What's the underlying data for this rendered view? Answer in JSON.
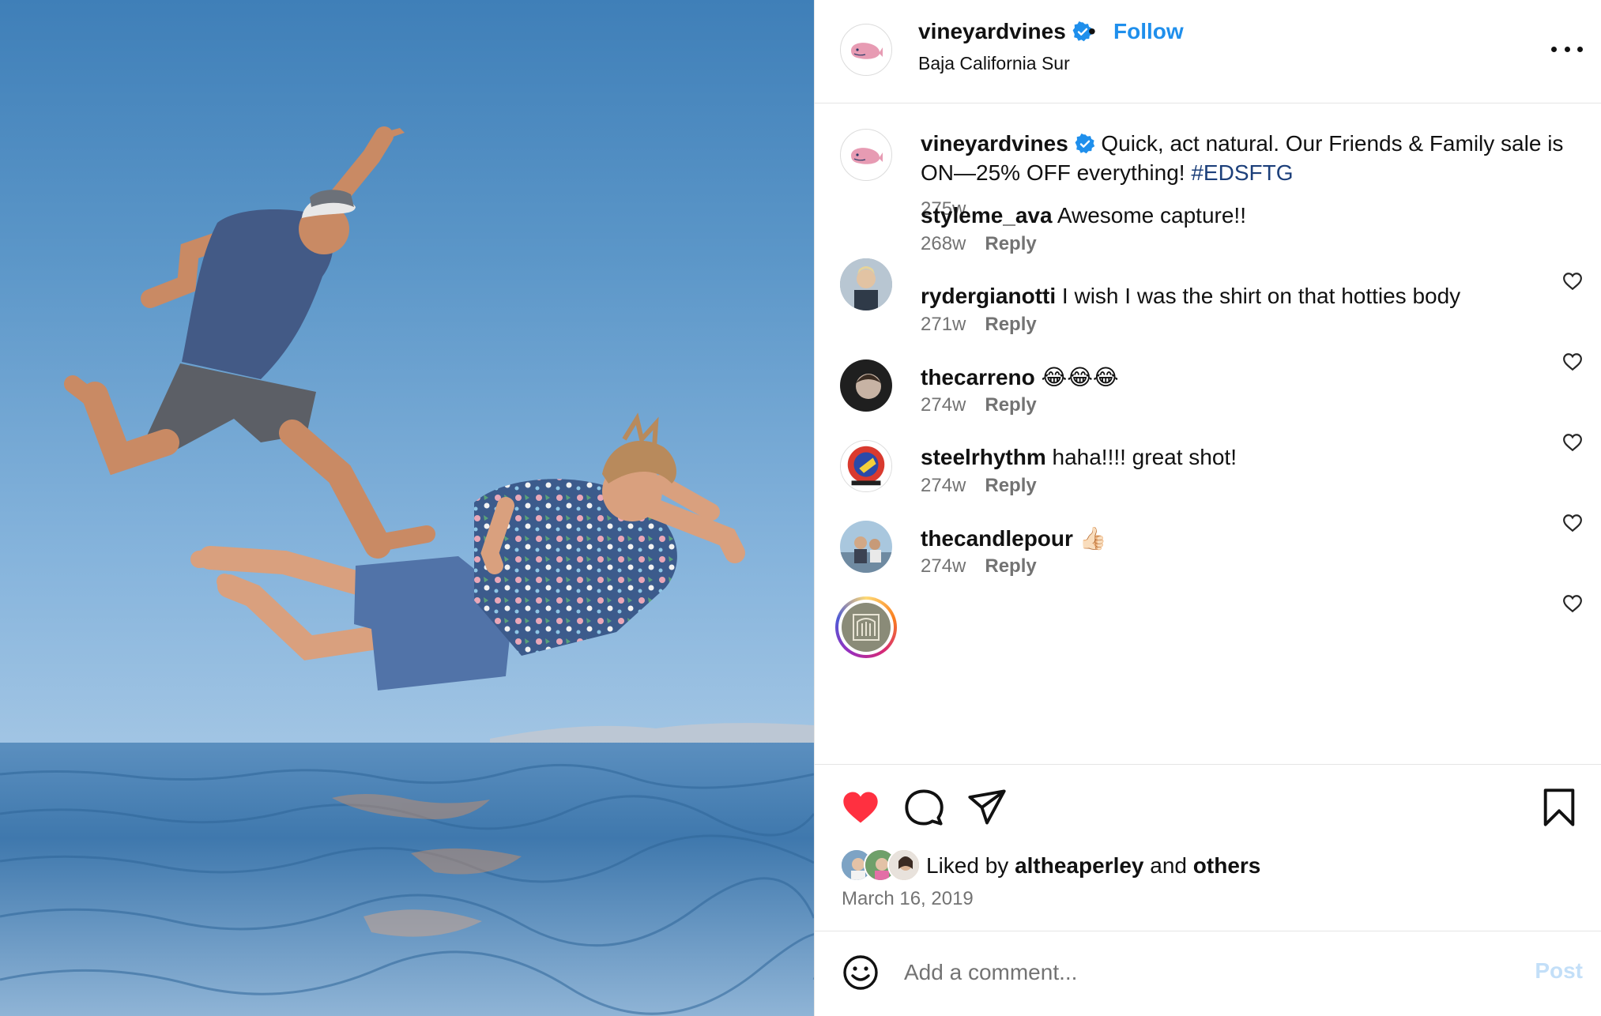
{
  "post": {
    "username": "vineyardvines",
    "verified": true,
    "follow_label": "Follow",
    "separator": "•",
    "location": "Baja California Sur",
    "more_icon": "more-horizontal-icon"
  },
  "caption": {
    "username": "vineyardvines",
    "text": "Quick, act natural. Our Friends & Family sale is ON—25% OFF everything! ",
    "hashtag": "#EDSFTG",
    "age": "275w"
  },
  "comments": [
    {
      "username": "styleme_ava",
      "text": "Awesome capture!!",
      "age": "268w",
      "reply_label": "Reply"
    },
    {
      "username": "rydergianotti",
      "text": "I wish I was the shirt on that hotties body",
      "age": "271w",
      "reply_label": "Reply"
    },
    {
      "username": "thecarreno",
      "text": "😂😂😂",
      "age": "274w",
      "reply_label": "Reply"
    },
    {
      "username": "steelrhythm",
      "text": "haha!!!! great shot!",
      "age": "274w",
      "reply_label": "Reply"
    },
    {
      "username": "thecandlepour",
      "text": "👍🏻",
      "age": "274w",
      "reply_label": "Reply"
    }
  ],
  "actions": {
    "like_icon": "heart-filled-icon",
    "comment_icon": "comment-bubble-icon",
    "share_icon": "paper-plane-icon",
    "save_icon": "bookmark-icon",
    "liked_color": "#ff3040"
  },
  "likes": {
    "prefix": "Liked by ",
    "user": "altheaperley",
    "middle": " and ",
    "others": "others"
  },
  "date": "March 16, 2019",
  "compose": {
    "placeholder": "Add a comment...",
    "post_label": "Post",
    "emoji_icon": "emoji-smile-icon"
  },
  "colors": {
    "link_blue": "#1f8fec",
    "hashtag": "#1c3f7a",
    "muted": "#737373",
    "post_disabled": "#c3dff8"
  }
}
